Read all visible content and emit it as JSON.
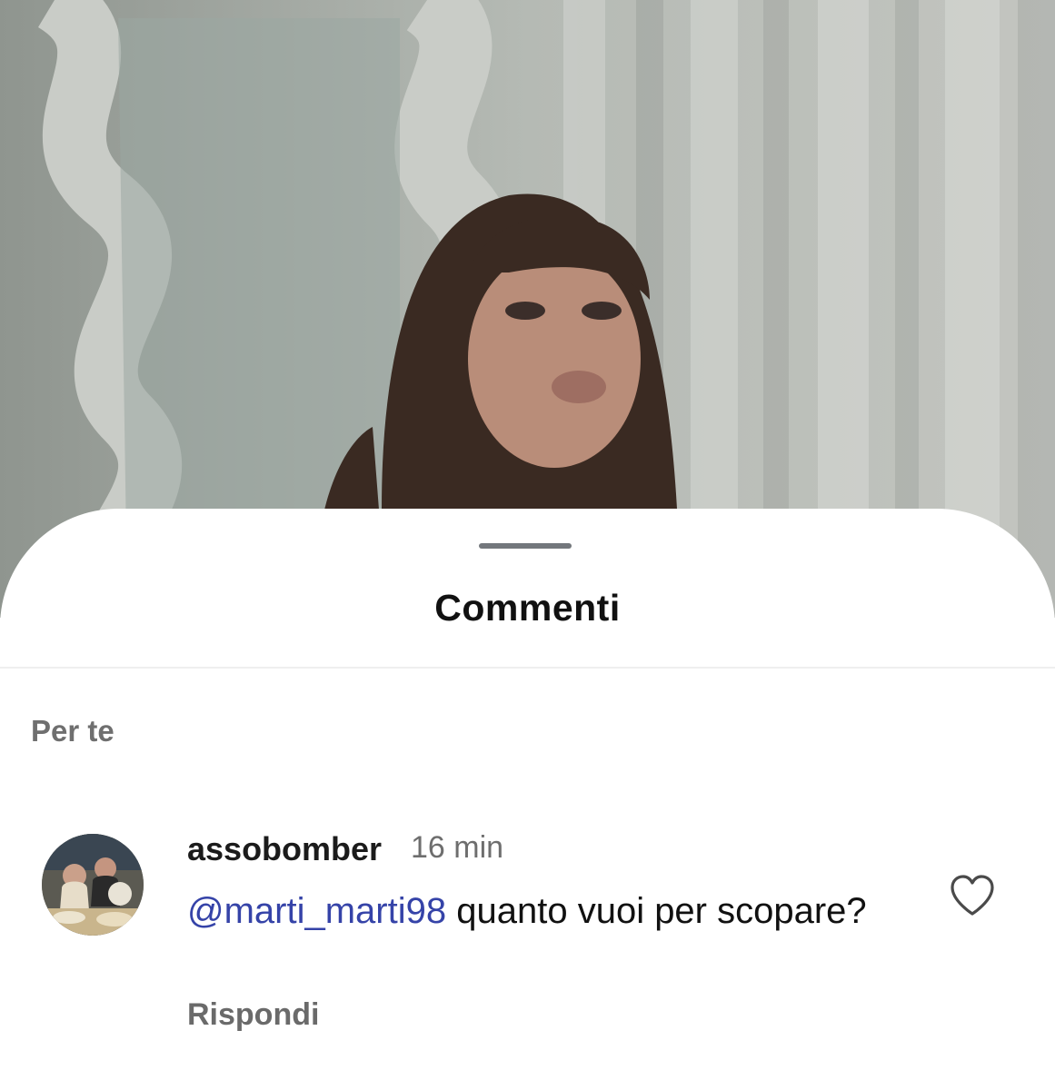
{
  "sheet": {
    "title": "Commenti",
    "section_label": "Per te"
  },
  "comment": {
    "username": "assobomber",
    "time": "16 min",
    "mention": "@marti_marti98",
    "text": " quanto vuoi per scopare?",
    "reply_label": "Rispondi",
    "like_icon": "heart-outline-icon",
    "mention_color": "#3543a8"
  }
}
